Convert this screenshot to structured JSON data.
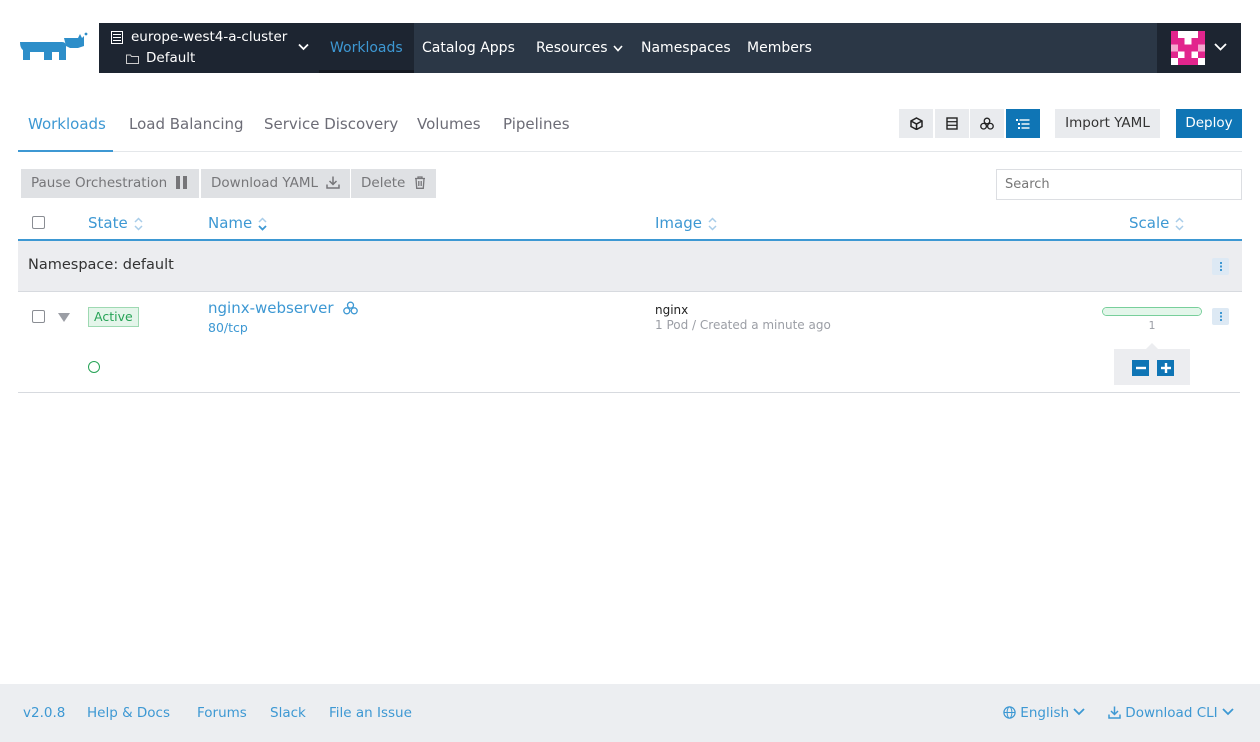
{
  "header": {
    "cluster_name": "europe-west4-a-cluster",
    "project_name": "Default",
    "nav": [
      {
        "label": "Workloads",
        "active": true
      },
      {
        "label": "Catalog Apps"
      },
      {
        "label": "Resources",
        "dropdown": true
      },
      {
        "label": "Namespaces"
      },
      {
        "label": "Members"
      }
    ]
  },
  "subtabs": [
    "Workloads",
    "Load Balancing",
    "Service Discovery",
    "Volumes",
    "Pipelines"
  ],
  "toolbar": {
    "views": [
      "namespace-view-icon",
      "node-view-icon",
      "group-view-icon",
      "list-view-icon"
    ],
    "import_label": "Import YAML",
    "deploy_label": "Deploy"
  },
  "bulk_actions": {
    "pause": "Pause Orchestration",
    "download": "Download YAML",
    "delete": "Delete"
  },
  "search": {
    "placeholder": "Search",
    "value": ""
  },
  "table": {
    "columns": [
      "State",
      "Name",
      "Image",
      "Scale"
    ],
    "group": {
      "label": "Namespace: default"
    },
    "rows": [
      {
        "state": "Active",
        "name": "nginx-webserver",
        "port": "80/tcp",
        "image": "nginx",
        "meta": "1 Pod / Created a minute ago",
        "scale": "1",
        "scale_fraction": 1.0
      }
    ]
  },
  "footer": {
    "version": "v2.0.8",
    "help": "Help & Docs",
    "forums": "Forums",
    "slack": "Slack",
    "issue": "File an Issue",
    "language": "English",
    "cli": "Download CLI"
  },
  "colors": {
    "accent": "#3d98d3",
    "primary_button": "#0f75b5",
    "nav_bg": "#2b3746",
    "active_green": "#26a356"
  }
}
